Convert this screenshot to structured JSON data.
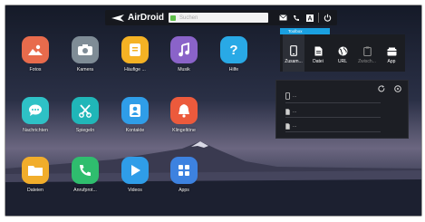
{
  "topbar": {
    "brand": "AirDroid",
    "search_placeholder": "Suchen",
    "icons": [
      "mail-icon",
      "phone-icon",
      "font-icon",
      "power-icon"
    ]
  },
  "apps": [
    {
      "label": "Fotos",
      "icon": "photos-icon",
      "color": "#e86b4c"
    },
    {
      "label": "Kamera",
      "icon": "camera-icon",
      "color": "#7f8c96"
    },
    {
      "label": "Häufige ...",
      "icon": "files-icon",
      "color": "#f5b224"
    },
    {
      "label": "Musik",
      "icon": "music-icon",
      "color": "#8a63c9"
    },
    {
      "label": "Hilfe",
      "icon": "help-icon",
      "color": "#29a9e6"
    },
    {
      "label": "Nachrichten",
      "icon": "messages-icon",
      "color": "#2ec1c6"
    },
    {
      "label": "Spiegeln",
      "icon": "mirror-icon",
      "color": "#20b6b8"
    },
    {
      "label": "Kontakte",
      "icon": "contacts-icon",
      "color": "#2f9de8"
    },
    {
      "label": "Klingeltöne",
      "icon": "bell-icon",
      "color": "#ec5a3c"
    },
    {
      "label": "Dateien",
      "icon": "folder-icon",
      "color": "#f1ad2b"
    },
    {
      "label": "Anrufprot...",
      "icon": "call-log-icon",
      "color": "#2fbd6e"
    },
    {
      "label": "Videos",
      "icon": "video-icon",
      "color": "#2f9de8"
    },
    {
      "label": "Apps",
      "icon": "apps-grid-icon",
      "color": "#3d82e0"
    }
  ],
  "toolbox": {
    "tab": "Toolbox",
    "tools": [
      {
        "label": "Zusam...",
        "icon": "phone-device-icon"
      },
      {
        "label": "Datei",
        "icon": "file-icon"
      },
      {
        "label": "URL",
        "icon": "globe-icon"
      },
      {
        "label": "Zwisch...",
        "icon": "clipboard-icon"
      },
      {
        "label": "App",
        "icon": "app-box-icon"
      }
    ]
  },
  "panel": {
    "rows": [
      "...",
      "...",
      "..."
    ]
  },
  "colors": {
    "accent": "#1aa0e0",
    "topbar": "#16181e",
    "panel": "#1c1e24"
  }
}
